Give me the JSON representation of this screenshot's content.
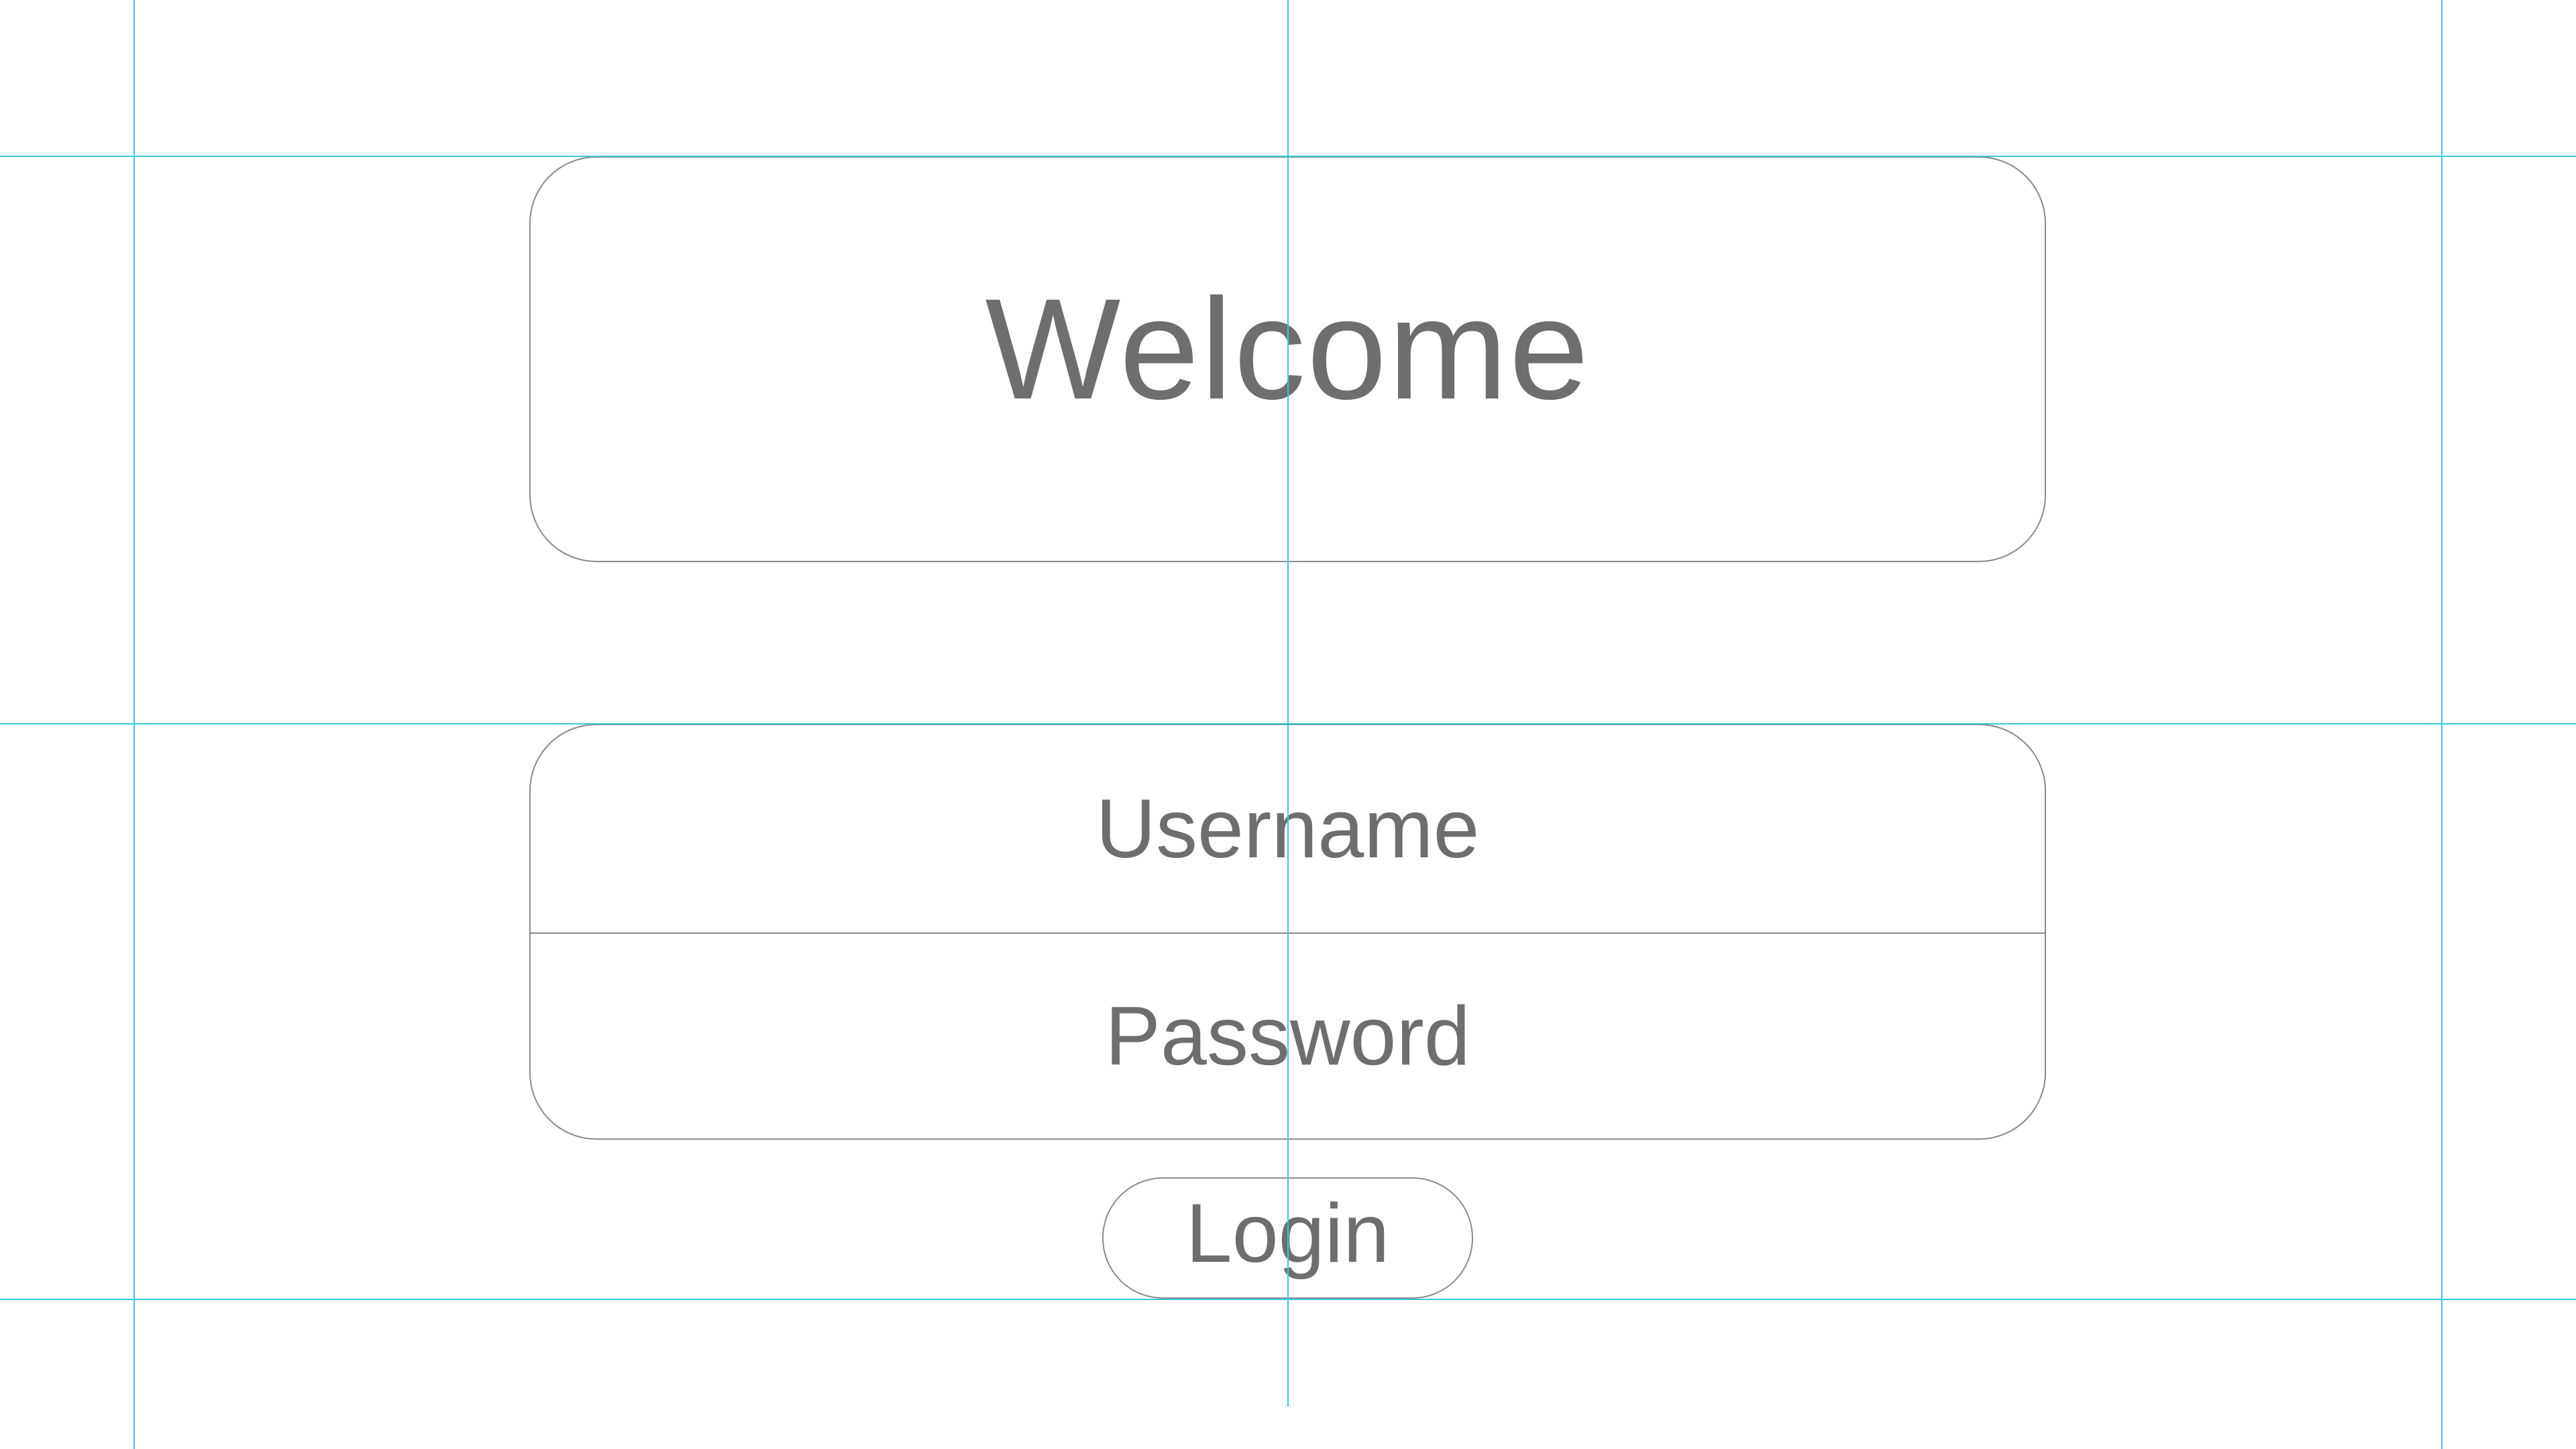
{
  "welcome": {
    "title": "Welcome"
  },
  "form": {
    "username_placeholder": "Username",
    "password_placeholder": "Password",
    "login_label": "Login"
  },
  "colors": {
    "text": "#6e6e6e",
    "border": "#8a8a8a",
    "guide": "#35c8df",
    "background": "#ffffff"
  }
}
